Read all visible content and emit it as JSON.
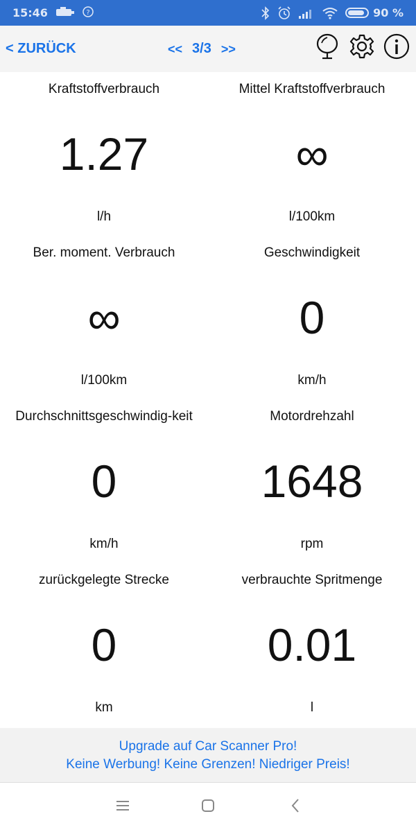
{
  "status_bar": {
    "time": "15:46",
    "battery_percent": "90 %",
    "battery_level": 0.9
  },
  "header": {
    "back_label": "< ZURÜCK",
    "prev_label": "<<",
    "page_indicator": "3/3",
    "next_label": ">>"
  },
  "gauges": [
    {
      "label": "Kraftstoffverbrauch",
      "value": "1.27",
      "unit": "l/h"
    },
    {
      "label": "Mittel Kraftstoffverbrauch",
      "value": "∞",
      "unit": "l/100km"
    },
    {
      "label": "Ber. moment. Verbrauch",
      "value": "∞",
      "unit": "l/100km"
    },
    {
      "label": "Geschwindigkeit",
      "value": "0",
      "unit": "km/h"
    },
    {
      "label": "Durchschnittsgeschwindig-keit",
      "value": "0",
      "unit": "km/h"
    },
    {
      "label": "Motordrehzahl",
      "value": "1648",
      "unit": "rpm"
    },
    {
      "label": "zurückgelegte Strecke",
      "value": "0",
      "unit": "km"
    },
    {
      "label": "verbrauchte Spritmenge",
      "value": "0.01",
      "unit": "l"
    }
  ],
  "promo": {
    "line1": "Upgrade auf Car Scanner Pro!",
    "line2": "Keine Werbung! Keine Grenzen! Niedriger Preis!"
  },
  "colors": {
    "status_bar": "#2f6fce",
    "accent": "#1a73e8"
  }
}
